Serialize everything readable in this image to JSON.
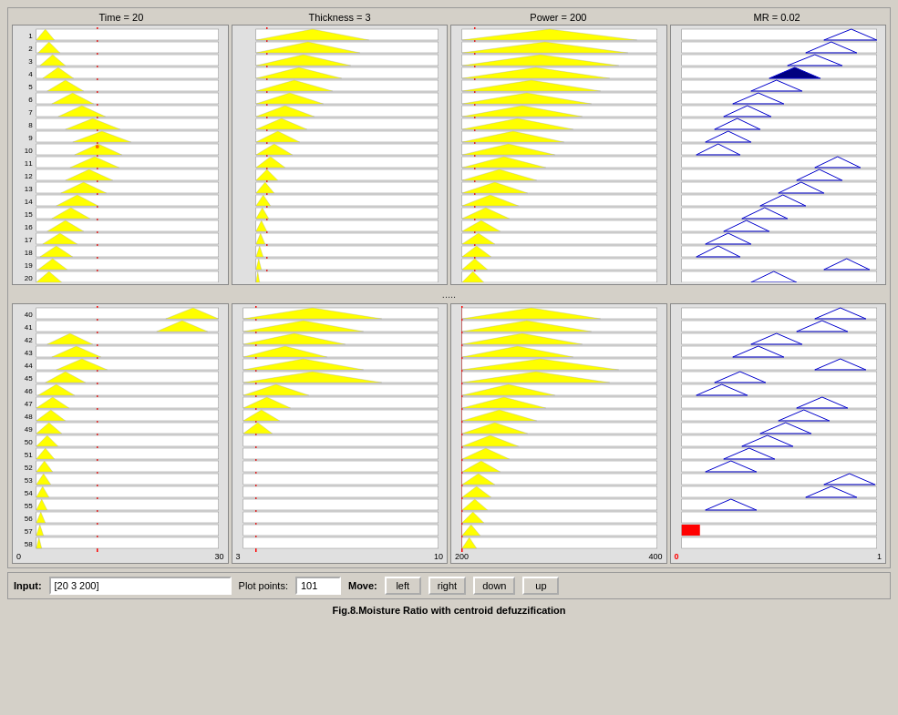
{
  "header": {
    "title": "Moisture Ratio with centroid defuzzification",
    "figure": "Fig.8."
  },
  "panels": {
    "top_titles": [
      "Time = 20",
      "Thickness = 3",
      "Power = 200",
      "MR = 0.02"
    ],
    "top_rows_start": 1,
    "top_rows_end": 20,
    "bottom_rows_start": 40,
    "bottom_rows_end": 58,
    "separator": ".....",
    "axis": {
      "panel1": {
        "min": "0",
        "mid": "",
        "max": "30"
      },
      "panel2": {
        "min": "3",
        "mid": "",
        "max": "10"
      },
      "panel3": {
        "min": "200",
        "mid": "",
        "max": "400"
      },
      "panel4": {
        "min": "0",
        "mid": "",
        "max": "1"
      }
    }
  },
  "bottom_bar": {
    "input_label": "Input:",
    "input_value": "[20 3 200]",
    "plot_points_label": "Plot points:",
    "plot_points_value": "101",
    "move_label": "Move:",
    "buttons": [
      "left",
      "right",
      "down",
      "up"
    ]
  }
}
